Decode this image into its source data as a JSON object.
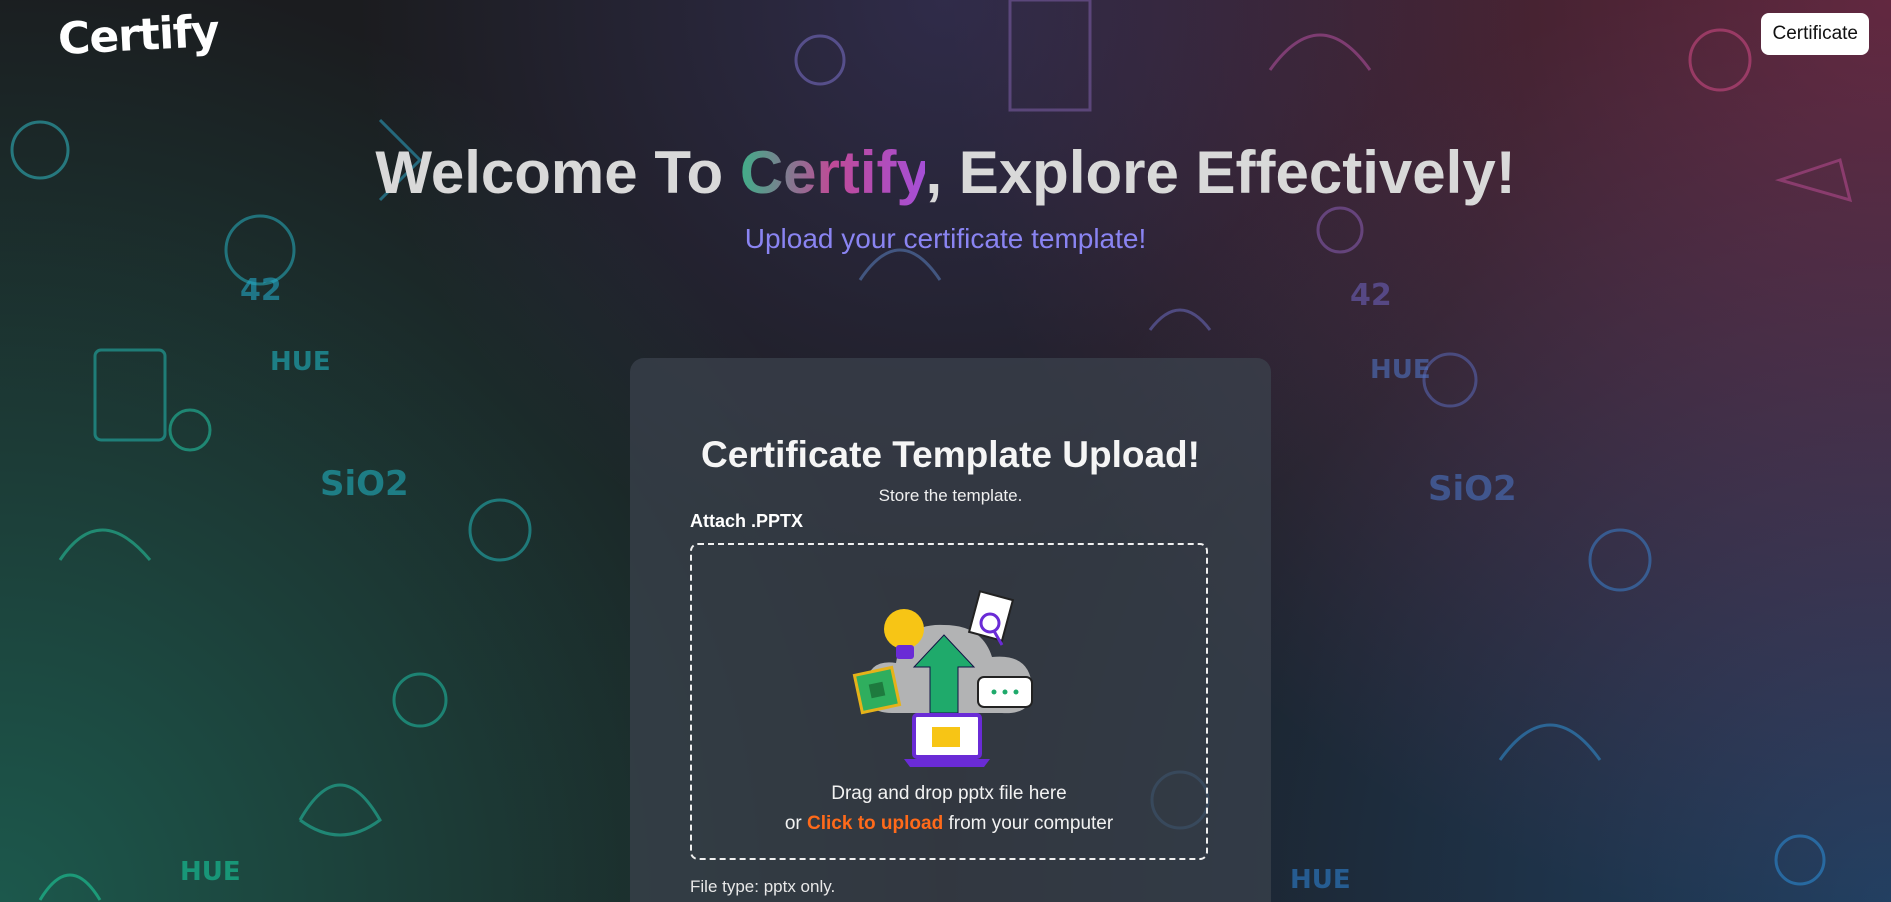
{
  "header": {
    "logo_text": "Certify",
    "nav_button_label": "Certificate"
  },
  "hero": {
    "title_before": "Welcome To ",
    "title_brand": "Certify",
    "title_after": ", Explore Effectively!",
    "subtitle": "Upload your certificate template!"
  },
  "upload_card": {
    "title": "Certificate Template Upload!",
    "subtitle": "Store the template.",
    "field_label": "Attach .PPTX",
    "drop_text": "Drag and drop pptx file here",
    "drop_prefix": "or ",
    "upload_link": "Click to upload",
    "drop_suffix": " from your computer",
    "file_type_note": "File type: pptx only.",
    "illustration_icon": "cloud-upload-icon"
  },
  "colors": {
    "brand_gradient_start": "#3fae88",
    "brand_gradient_end": "#a54fd6",
    "subtitle": "#8a84f2",
    "upload_link": "#ff6a1a",
    "arrow": "#1faa6b",
    "laptop": "#6a2bd6"
  }
}
